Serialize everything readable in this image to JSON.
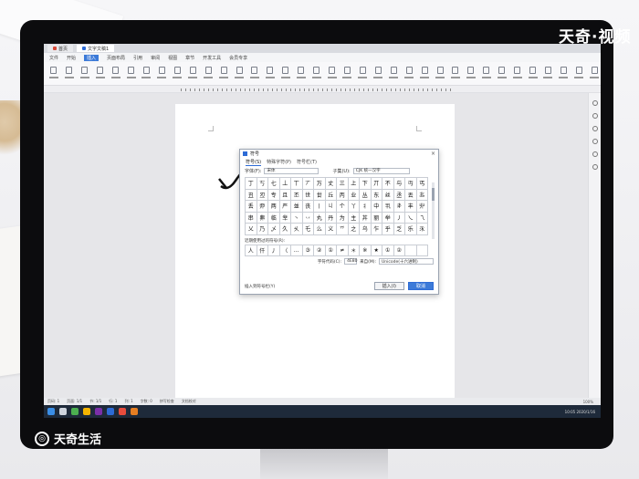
{
  "watermark_top": "天奇·视频",
  "watermark_bottom": "天奇生活",
  "tabs": [
    {
      "label": "首页"
    },
    {
      "label": "文字文稿1"
    }
  ],
  "menu": [
    "文件",
    "开始",
    "插入",
    "页面布局",
    "引用",
    "审阅",
    "视图",
    "章节",
    "开发工具",
    "会员专享"
  ],
  "menu_active_index": 2,
  "dialog": {
    "title": "符号",
    "close": "×",
    "tabs": [
      "符号(S)",
      "特殊字符(P)",
      "符号栏(T)"
    ],
    "font_label": "字体(F):",
    "font_value": "宋体",
    "subset_label": "子集(U):",
    "subset_value": "CJK 统一汉字",
    "symbols": [
      "丁",
      "丂",
      "七",
      "丄",
      "丅",
      "丆",
      "万",
      "丈",
      "三",
      "上",
      "下",
      "丌",
      "不",
      "与",
      "丏",
      "丐",
      "丑",
      "丒",
      "专",
      "且",
      "丕",
      "世",
      "丗",
      "丘",
      "丙",
      "业",
      "丛",
      "东",
      "丝",
      "丞",
      "丟",
      "丠",
      "丢",
      "丣",
      "两",
      "严",
      "並",
      "丧",
      "丨",
      "丩",
      "个",
      "丫",
      "丬",
      "中",
      "丮",
      "丯",
      "丰",
      "丱",
      "串",
      "丳",
      "临",
      "丵",
      "丶",
      "丷",
      "丸",
      "丹",
      "为",
      "主",
      "丼",
      "丽",
      "举",
      "丿",
      "乀",
      "乁",
      "乂",
      "乃",
      "乄",
      "久",
      "乆",
      "乇",
      "么",
      "义",
      "乊",
      "之",
      "乌",
      "乍",
      "乎",
      "乏",
      "乐",
      "乑"
    ],
    "recent_label": "近期使用过的符号(R):",
    "recent": [
      "人",
      "仟",
      "丿",
      "〈",
      "…",
      "③",
      "②",
      "①",
      "≠",
      "＊",
      "※",
      "★",
      "①",
      "②",
      "",
      ""
    ],
    "code_label": "字符代码(C):",
    "code_value": "4E80",
    "from_label": "来自(M):",
    "from_value": "Unicode(十六进制)",
    "shortcut_label": "插入到符号栏(Y)",
    "insert_button": "插入(I)",
    "cancel_button": "取消"
  },
  "status": [
    "页码: 1",
    "页面: 1/1",
    "节: 1/1",
    "行: 1",
    "列: 1",
    "字数: 0",
    "拼写检查",
    "文档校对"
  ],
  "zoom": "100%",
  "tray_time": "10:05",
  "tray_date": "2020/1/16"
}
